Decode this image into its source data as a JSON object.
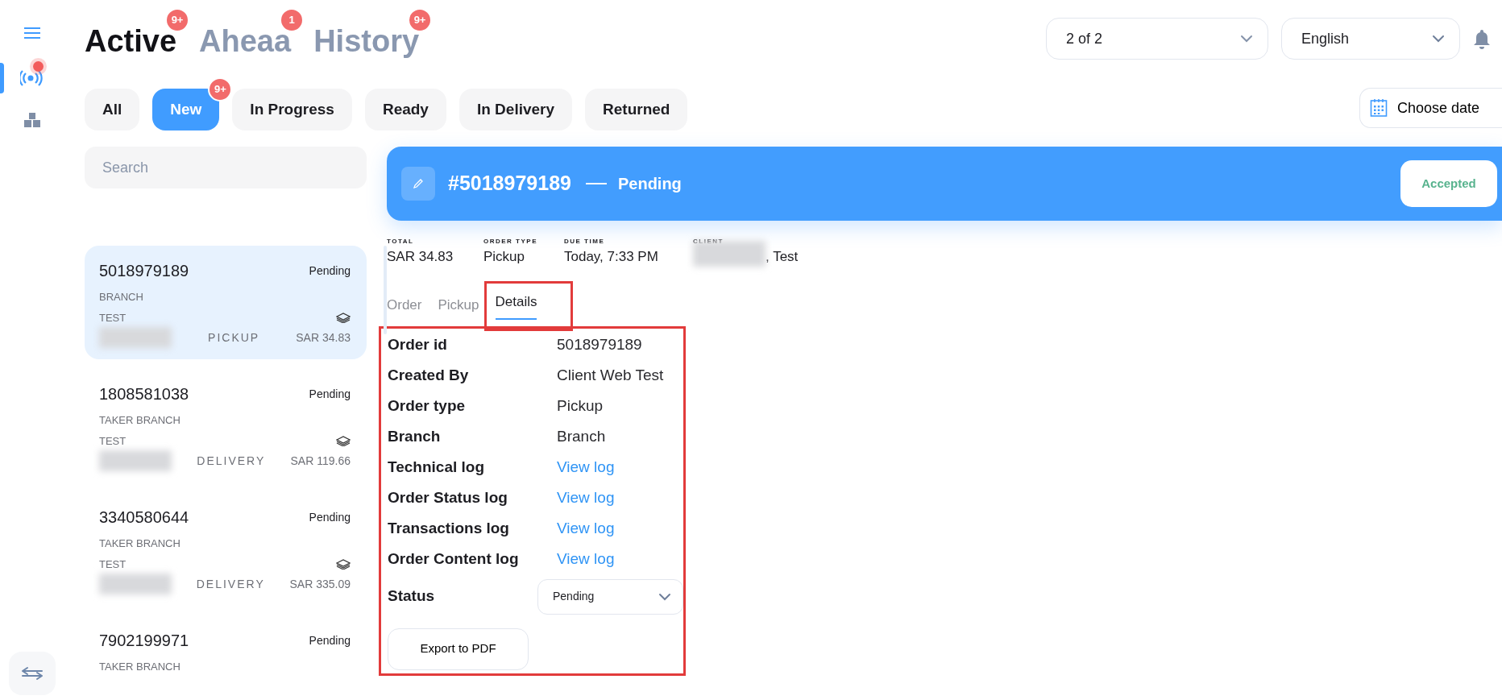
{
  "sidebar": {
    "items": [
      {
        "kind": "menu",
        "selected": false
      },
      {
        "kind": "live",
        "selected": true,
        "alert": true
      },
      {
        "kind": "boxes",
        "selected": false
      }
    ],
    "bottom_button": {
      "kind": "swap"
    }
  },
  "view_tabs": [
    {
      "label": "Active",
      "badge": "9+",
      "selected": true
    },
    {
      "label": "Aheaa",
      "badge": "1",
      "selected": false
    },
    {
      "label": "History",
      "badge": "9+",
      "selected": false
    }
  ],
  "branch_select": {
    "value": "2 of 2"
  },
  "language_select": {
    "value": "English"
  },
  "filters": [
    {
      "label": "All",
      "selected": false
    },
    {
      "label": "New",
      "selected": true,
      "badge": "9+"
    },
    {
      "label": "In Progress",
      "selected": false
    },
    {
      "label": "Ready",
      "selected": false
    },
    {
      "label": "In Delivery",
      "selected": false
    },
    {
      "label": "Returned",
      "selected": false
    }
  ],
  "date_button": {
    "label": "Choose date"
  },
  "search": {
    "placeholder": "Search"
  },
  "orders": [
    {
      "number": "5018979189",
      "status": "Pending",
      "branch": "BRANCH",
      "client": "TEST",
      "phone_redacted": true,
      "type": "PICKUP",
      "price": "SAR 34.83",
      "selected": true
    },
    {
      "number": "1808581038",
      "status": "Pending",
      "branch": "TAKER BRANCH",
      "client": "TEST",
      "phone_redacted": true,
      "type": "DELIVERY",
      "price": "SAR 119.66",
      "selected": false
    },
    {
      "number": "3340580644",
      "status": "Pending",
      "branch": "TAKER BRANCH",
      "client": "TEST",
      "phone_redacted": true,
      "type": "DELIVERY",
      "price": "SAR 335.09",
      "selected": false
    },
    {
      "number": "7902199971",
      "status": "Pending",
      "branch": "TAKER BRANCH",
      "selected": false
    }
  ],
  "order_header": {
    "number": "#5018979189",
    "status": "Pending",
    "action": "Accepted"
  },
  "summary": [
    {
      "label": "TOTAL",
      "value": "SAR 34.83"
    },
    {
      "label": "ORDER TYPE",
      "value": "Pickup"
    },
    {
      "label": "DUE TIME",
      "value": "Today, 7:33 PM"
    },
    {
      "label": "CLIENT",
      "value": ", Test",
      "redacted": true
    }
  ],
  "detail_tabs": [
    {
      "label": "Order",
      "selected": false,
      "highlighted": false
    },
    {
      "label": "Pickup",
      "selected": false,
      "highlighted": false
    },
    {
      "label": "Details",
      "selected": true,
      "highlighted": true
    }
  ],
  "details": {
    "highlighted": true,
    "rows": [
      {
        "label": "Order id",
        "value": "5018979189",
        "kind": "text"
      },
      {
        "label": "Created By",
        "value": "Client Web Test",
        "kind": "text"
      },
      {
        "label": "Order type",
        "value": "Pickup",
        "kind": "text"
      },
      {
        "label": "Branch",
        "value": "Branch",
        "kind": "text"
      },
      {
        "label": "Technical log",
        "value": "View log",
        "kind": "link"
      },
      {
        "label": "Order Status log",
        "value": "View log",
        "kind": "link"
      },
      {
        "label": "Transactions log",
        "value": "View log",
        "kind": "link"
      },
      {
        "label": "Order Content log",
        "value": "View log",
        "kind": "link"
      },
      {
        "label": "Status",
        "value": "Pending",
        "kind": "select"
      }
    ],
    "export_button": "Export to PDF"
  }
}
